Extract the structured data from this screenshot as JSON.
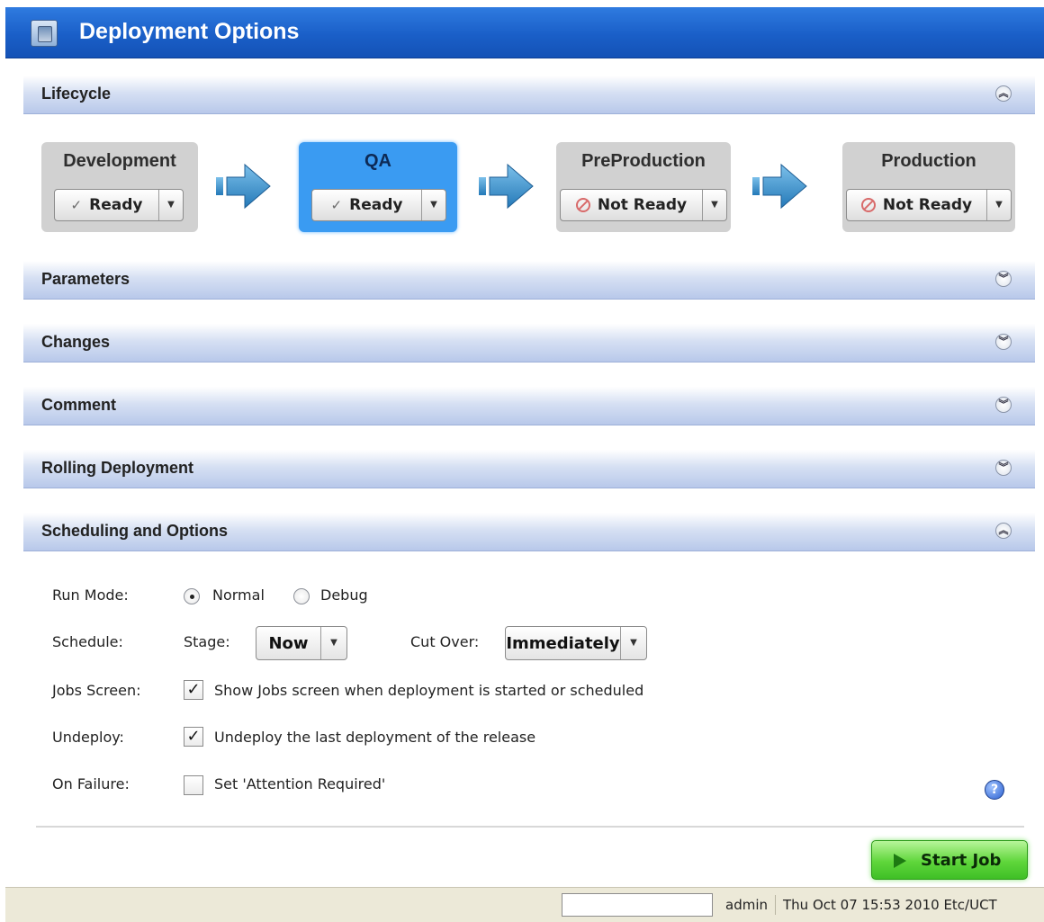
{
  "window": {
    "title": "Deployment Options"
  },
  "sections": {
    "lifecycle": "Lifecycle",
    "parameters": "Parameters",
    "changes": "Changes",
    "comment": "Comment",
    "rolling": "Rolling Deployment",
    "scheduling": "Scheduling and Options"
  },
  "stages": [
    {
      "name": "Development",
      "status": "Ready",
      "status_icon": "check-icon",
      "active": false
    },
    {
      "name": "QA",
      "status": "Ready",
      "status_icon": "check-icon",
      "active": true
    },
    {
      "name": "PreProduction",
      "status": "Not Ready",
      "status_icon": "no-entry-icon",
      "active": false
    },
    {
      "name": "Production",
      "status": "Not Ready",
      "status_icon": "no-entry-icon",
      "active": false
    }
  ],
  "options": {
    "run_mode": {
      "label": "Run Mode:",
      "normal": "Normal",
      "debug": "Debug",
      "selected": "Normal"
    },
    "schedule": {
      "label": "Schedule:",
      "stage_label": "Stage:",
      "stage_value": "Now",
      "cutover_label": "Cut Over:",
      "cutover_value": "Immediately"
    },
    "jobs_screen": {
      "label": "Jobs Screen:",
      "text": "Show Jobs screen when deployment is started or scheduled",
      "checked": true
    },
    "undeploy": {
      "label": "Undeploy:",
      "text": "Undeploy the last deployment of the release",
      "checked": true
    },
    "on_failure": {
      "label": "On Failure:",
      "text": "Set 'Attention Required'",
      "checked": false
    }
  },
  "actions": {
    "start_job": "Start Job"
  },
  "status_bar": {
    "user": "admin",
    "timestamp": "Thu Oct 07 15:53 2010 Etc/UCT"
  },
  "colors": {
    "title_bar": "#1a5fc8",
    "active_stage": "#3a9bf2",
    "stage": "#d1d1d1",
    "start_button": "#5fd63b"
  }
}
